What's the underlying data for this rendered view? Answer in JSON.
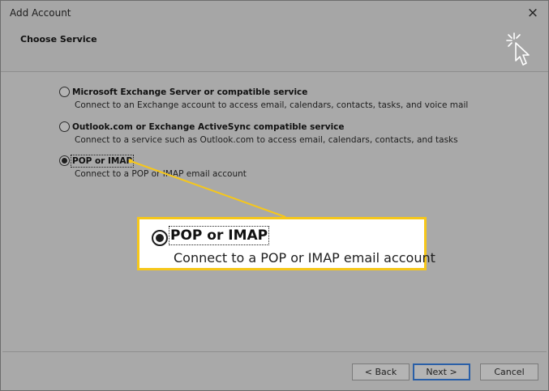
{
  "window": {
    "title": "Add Account",
    "close_symbol": "×"
  },
  "header": {
    "title": "Choose Service",
    "icon": "wizard-cursor-icon"
  },
  "options": [
    {
      "label": "Microsoft Exchange Server or compatible service",
      "description": "Connect to an Exchange account to access email, calendars, contacts, tasks, and voice mail",
      "selected": false
    },
    {
      "label": "Outlook.com or Exchange ActiveSync compatible service",
      "description": "Connect to a service such as Outlook.com to access email, calendars, contacts, and tasks",
      "selected": false
    },
    {
      "label": "POP or IMAP",
      "description": "Connect to a POP or IMAP email account",
      "selected": true
    }
  ],
  "callout": {
    "label": "POP or IMAP",
    "description": "Connect to a POP or IMAP email account",
    "border_color": "#f6c71a"
  },
  "footer": {
    "back_label": "< Back",
    "next_label": "Next >",
    "cancel_label": "Cancel"
  },
  "colors": {
    "accent": "#f6c71a",
    "default_button_border": "#2a5fa7",
    "dialog_bg": "#a9a9a9"
  }
}
